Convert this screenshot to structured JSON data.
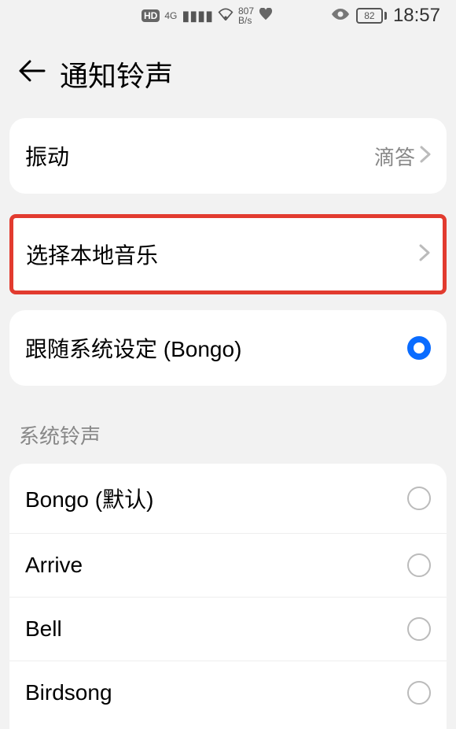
{
  "status": {
    "hd": "HD",
    "net_4g": "4G",
    "speed_top": "807",
    "speed_bottom": "B/s",
    "battery": "82",
    "time": "18:57"
  },
  "header": {
    "title": "通知铃声"
  },
  "vibration": {
    "label": "振动",
    "value": "滴答"
  },
  "local_music": {
    "label": "选择本地音乐"
  },
  "follow_system": {
    "label": "跟随系统设定 (Bongo)",
    "selected": true
  },
  "system_section": {
    "title": "系统铃声",
    "items": [
      {
        "label": "Bongo (默认)",
        "selected": false
      },
      {
        "label": "Arrive",
        "selected": false
      },
      {
        "label": "Bell",
        "selected": false
      },
      {
        "label": "Birdsong",
        "selected": false
      }
    ]
  }
}
